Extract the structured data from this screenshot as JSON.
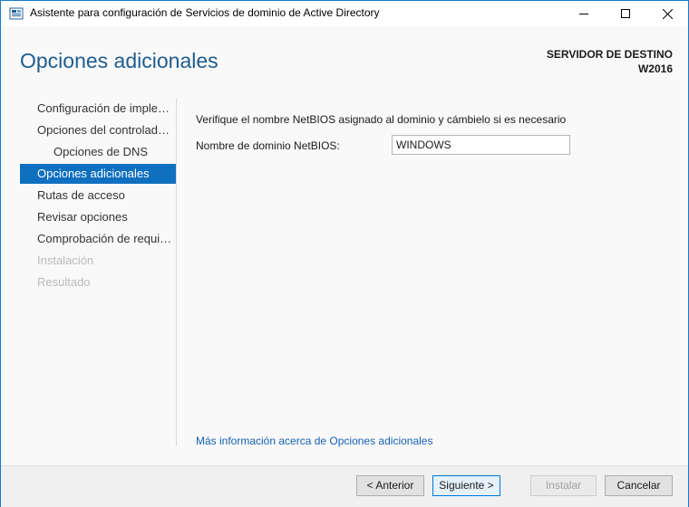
{
  "window": {
    "title": "Asistente para configuración de Servicios de dominio de Active Directory",
    "icon": "server-manager-icon"
  },
  "header": {
    "title": "Opciones adicionales",
    "destination_label": "SERVIDOR DE DESTINO",
    "destination_server": "W2016"
  },
  "nav": {
    "items": [
      {
        "label": "Configuración de implementación",
        "state": "normal"
      },
      {
        "label": "Opciones del controlador de dominio",
        "state": "normal"
      },
      {
        "label": "Opciones de DNS",
        "state": "normal"
      },
      {
        "label": "Opciones adicionales",
        "state": "active"
      },
      {
        "label": "Rutas de acceso",
        "state": "normal"
      },
      {
        "label": "Revisar opciones",
        "state": "normal"
      },
      {
        "label": "Comprobación de requisitos previos",
        "state": "normal"
      },
      {
        "label": "Instalación",
        "state": "disabled"
      },
      {
        "label": "Resultado",
        "state": "disabled"
      }
    ]
  },
  "content": {
    "instruction": "Verifique el nombre NetBIOS asignado al dominio y cámbielo si es necesario",
    "netbios_label": "Nombre de dominio NetBIOS:",
    "netbios_value": "WINDOWS",
    "more_info_link": "Más información acerca de Opciones adicionales"
  },
  "footer": {
    "prev_label": "< Anterior",
    "next_label": "Siguiente >",
    "install_label": "Instalar",
    "cancel_label": "Cancelar"
  },
  "colors": {
    "accent": "#1070c0",
    "title": "#1e5d8f",
    "link": "#1560b0",
    "border": "#1979ca"
  }
}
